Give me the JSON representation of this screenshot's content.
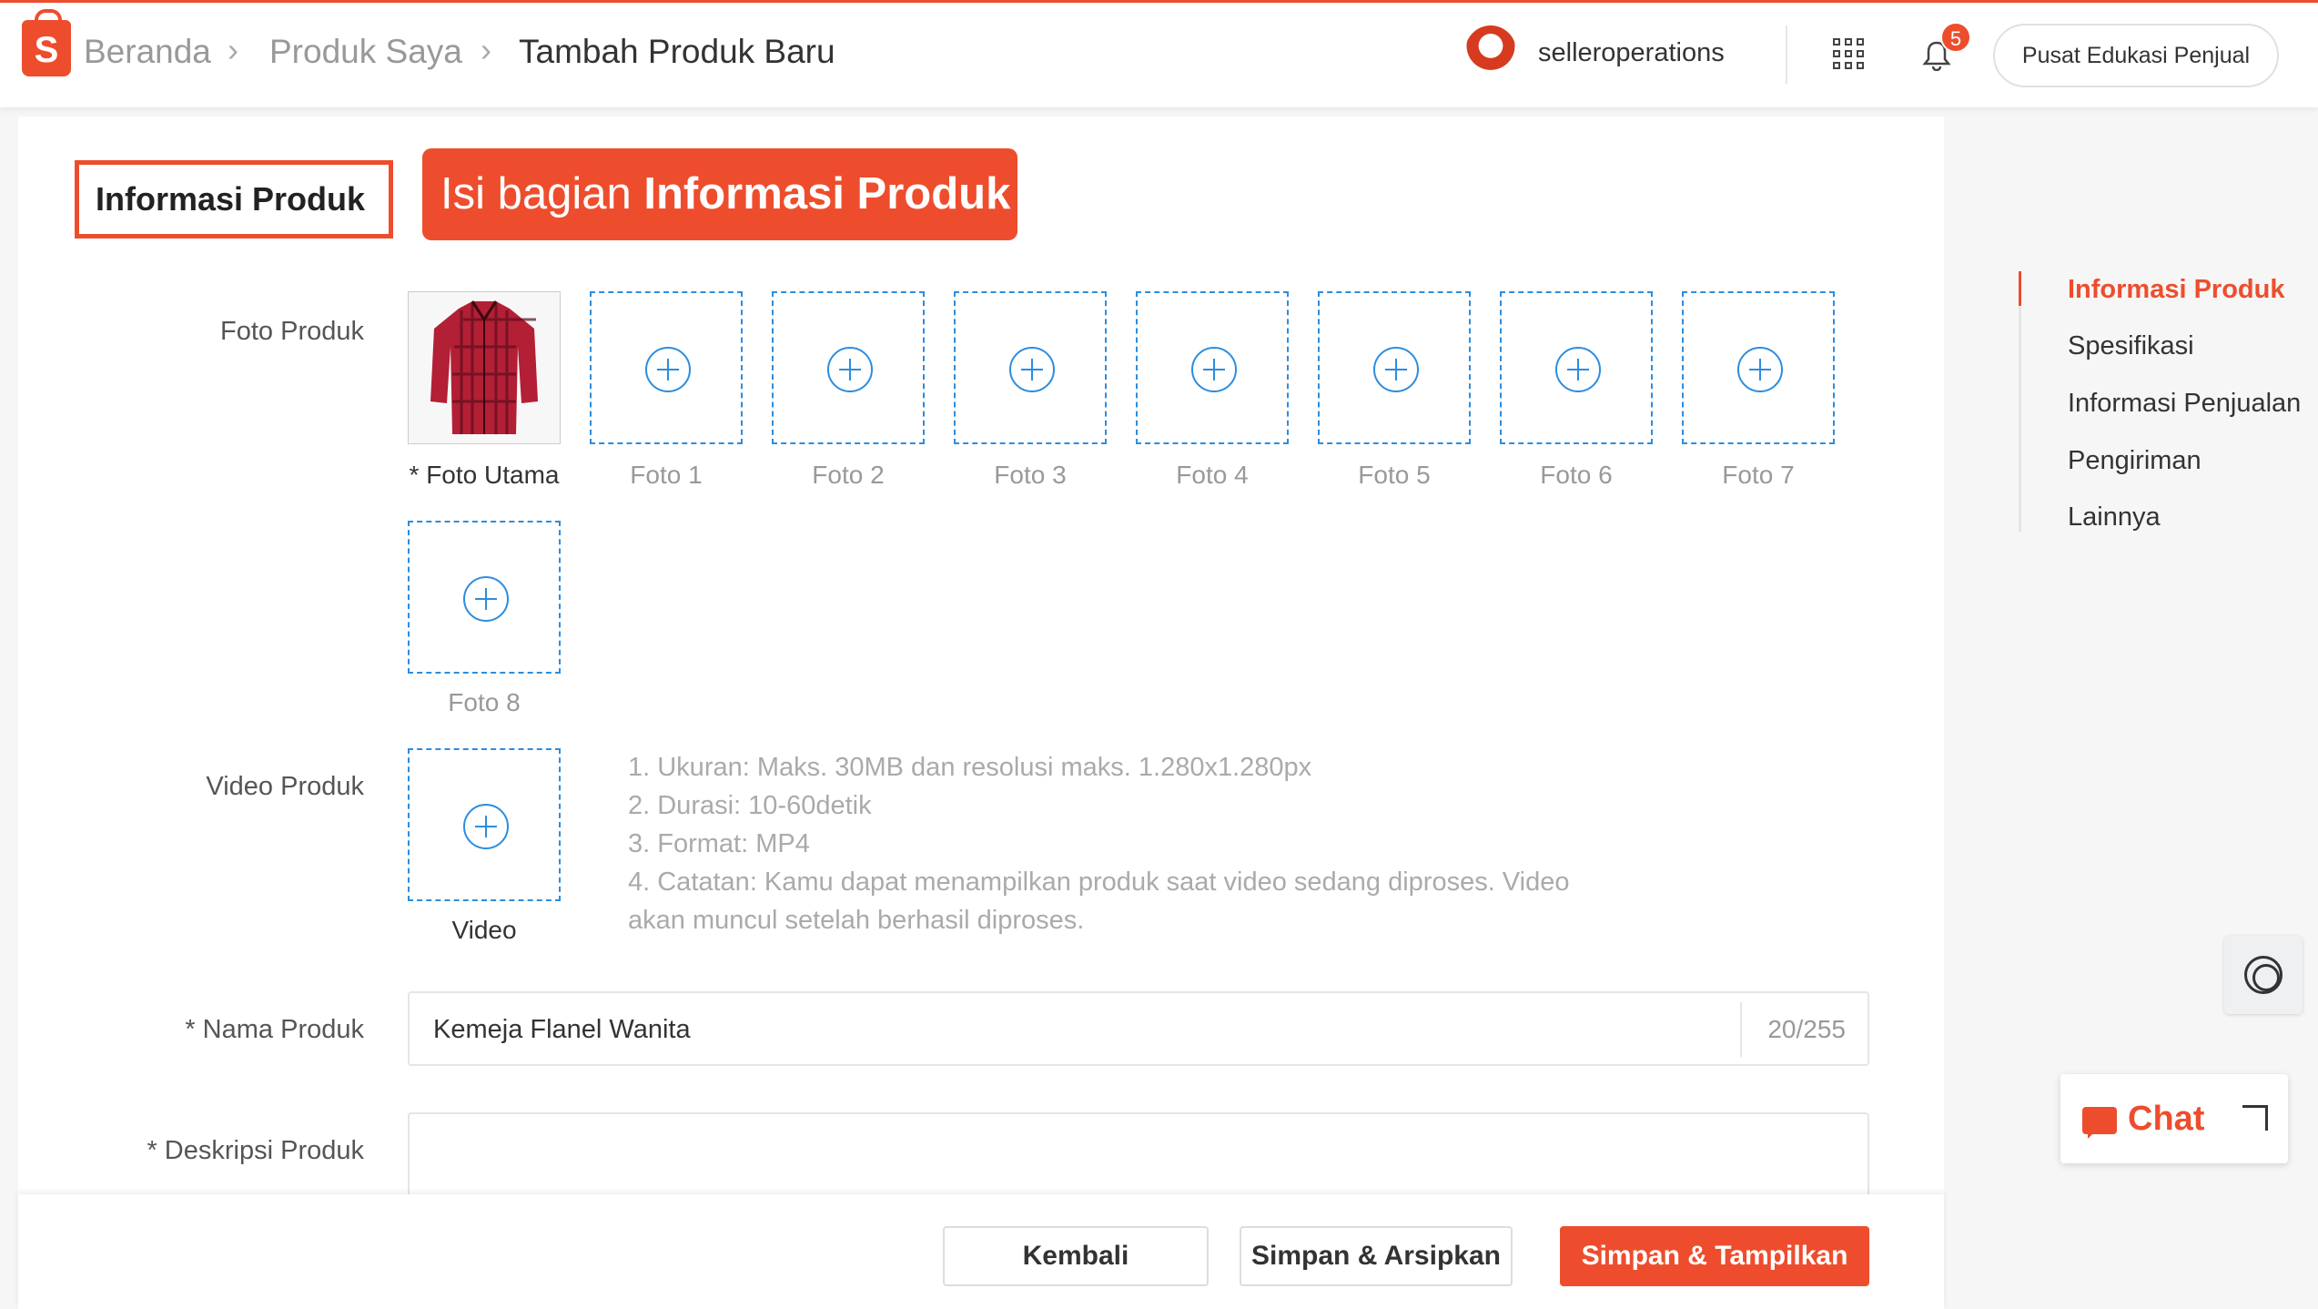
{
  "header": {
    "breadcrumb": [
      "Beranda",
      "Produk Saya",
      "Tambah Produk Baru"
    ],
    "username": "selleroperations",
    "notification_count": "5",
    "edu_button": "Pusat Edukasi Penjual"
  },
  "section": {
    "title": "Informasi Produk",
    "callout_prefix": "Isi bagian",
    "callout_bold": "Informasi Produk"
  },
  "form": {
    "foto_label": "Foto Produk",
    "photo_main": "Foto Utama",
    "photo_slots": [
      "Foto 1",
      "Foto 2",
      "Foto 3",
      "Foto 4",
      "Foto 5",
      "Foto 6",
      "Foto 7",
      "Foto 8"
    ],
    "video_label": "Video Produk",
    "video_caption": "Video",
    "video_hints": [
      "1. Ukuran: Maks. 30MB dan resolusi maks. 1.280x1.280px",
      "2. Durasi: 10-60detik",
      "3. Format: MP4",
      "4. Catatan: Kamu dapat menampilkan produk saat video sedang diproses. Video",
      "akan muncul setelah berhasil diproses."
    ],
    "name_label": "* Nama Produk",
    "name_value": "Kemeja Flanel Wanita",
    "name_count": "20/255",
    "desc_label": "* Deskripsi Produk"
  },
  "footer": {
    "back": "Kembali",
    "save_archive": "Simpan & Arsipkan",
    "save_show": "Simpan & Tampilkan"
  },
  "sidenav": [
    "Informasi Produk",
    "Spesifikasi",
    "Informasi Penjualan",
    "Pengiriman",
    "Lainnya"
  ],
  "chat": {
    "label": "Chat"
  },
  "colors": {
    "accent": "#ee4d2d",
    "link": "#2b8de0"
  }
}
